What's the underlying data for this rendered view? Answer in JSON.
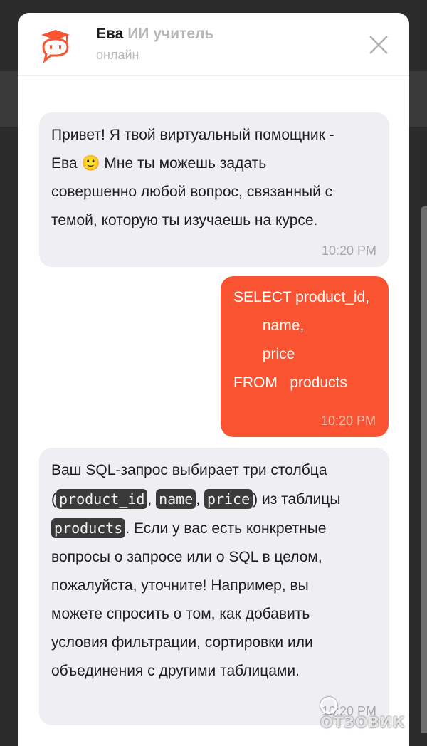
{
  "header": {
    "name": "Ева",
    "role": "ИИ учитель",
    "status": "онлайн"
  },
  "messages": [
    {
      "sender": "bot",
      "lines": [
        "Привет! Я твой виртуальный помощник -",
        "Ева 🙂 Мне ты можешь задать",
        "совершенно любой вопрос, связанный с",
        "темой, которую ты изучаешь на курсе."
      ],
      "time": "10:20 PM"
    },
    {
      "sender": "user",
      "lines": [
        "SELECT product_id,",
        "       name,",
        "       price",
        "FROM   products"
      ],
      "time": "10:20 PM"
    },
    {
      "sender": "bot",
      "intro": "Ваш SQL-запрос выбирает три столбца",
      "open_paren": "(",
      "code": [
        "product_id",
        "name",
        "price",
        "products"
      ],
      "sep": ", ",
      "after_cols": ") из таблицы",
      "after_table": ". Если у вас есть конкретные",
      "rest": [
        "вопросы о запросе или о SQL в целом,",
        "пожалуйста, уточните! Например, вы",
        "можете спросить о том, как добавить",
        "условия фильтрации, сортировки или",
        "объединения с другими таблицами."
      ],
      "time": "10:20 PM"
    }
  ],
  "watermark": "ОТЗОВИК",
  "colors": {
    "accent": "#fa5331",
    "bot_bubble": "#efeef3",
    "inline_code_bg": "#3a3a3a"
  },
  "icons": [
    "graduation-cap-chat-avatar-icon",
    "close-icon"
  ]
}
